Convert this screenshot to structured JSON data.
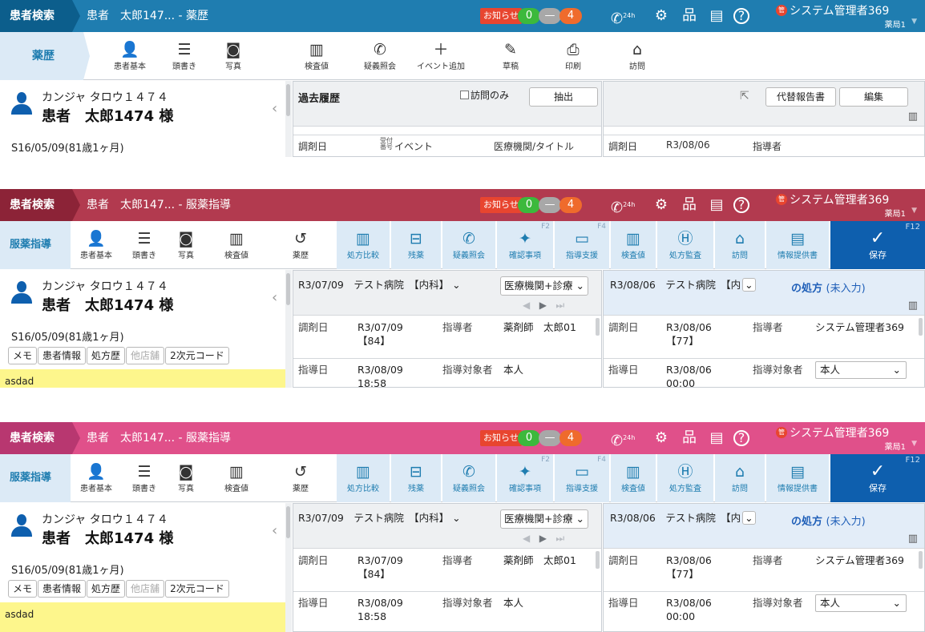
{
  "common": {
    "patient_search": "患者検索",
    "notice": "お知らせ",
    "count_green": "0",
    "count_gray": "—",
    "count_orange": "4",
    "phone_24h": "24h",
    "user_name": "システム管理者369",
    "user_pharmacy": "薬局1",
    "patient_kana": "カンジャ タロウ１４７４",
    "patient_name": "患者　太郎1474 様",
    "patient_birth": "S16/05/09(81歳1ヶ月)"
  },
  "panel1": {
    "title": "患者　太郎147... - 薬歴",
    "mode": "薬歴",
    "toolbar": [
      "患者基本",
      "頭書き",
      "写真",
      "検査値",
      "疑義照会",
      "イベント追加",
      "草稿",
      "印刷",
      "訪問"
    ],
    "mid": {
      "title": "過去履歴",
      "visit_only": "訪問のみ",
      "extract": "抽出",
      "columns": [
        "調剤日",
        "受付番号",
        "イベント",
        "医療機関/タイトル"
      ]
    },
    "right": {
      "alt_report": "代替報告書",
      "edit": "編集",
      "label_date": "調剤日",
      "date": "R3/08/06",
      "label_instructor": "指導者"
    }
  },
  "panel_sv": {
    "title": "患者　太郎147... - 服薬指導",
    "mode": "服薬指導",
    "toolbar": [
      "患者基本",
      "頭書き",
      "写真",
      "検査値",
      "薬歴",
      "処方比較",
      "残薬",
      "疑義照会",
      "確認事項",
      "指導支援",
      "検査値",
      "処方監査",
      "訪問",
      "情報提供書"
    ],
    "fkey_confirm": "F2",
    "fkey_support": "F4",
    "save": "保存",
    "save_fkey": "F12",
    "tags": [
      "メモ",
      "患者情報",
      "処方歴",
      "他店舗",
      "2次元コード"
    ],
    "memo": "asdad",
    "mid": {
      "select_main": "R3/07/09　テスト病院　【内科】",
      "select_filter": "医療機関+診療",
      "label_dispense": "調剤日",
      "dispense_date": "R3/07/09",
      "dispense_no": "【84】",
      "label_instructor": "指導者",
      "instructor": "薬剤師　太郎01",
      "label_guide": "指導日",
      "guide_date": "R3/08/09",
      "guide_time": "18:58",
      "label_target": "指導対象者",
      "target": "本人"
    },
    "right": {
      "select_main": "R3/08/06　テスト病院　【内",
      "rx_title": "の処方",
      "rx_status": "(未入力)",
      "label_dispense": "調剤日",
      "dispense_date": "R3/08/06",
      "dispense_no": "【77】",
      "label_instructor": "指導者",
      "instructor": "システム管理者369",
      "label_guide": "指導日",
      "guide_date": "R3/08/06",
      "guide_time": "00:00",
      "label_target": "指導対象者",
      "target": "本人"
    }
  }
}
